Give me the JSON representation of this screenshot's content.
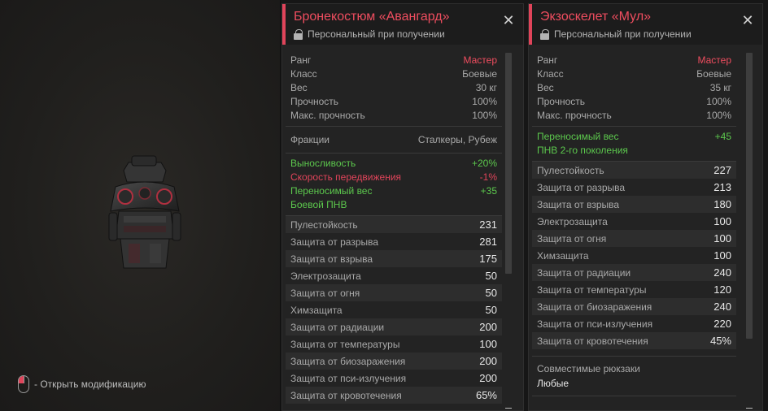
{
  "preview": {
    "hint": "- Открыть модификацию"
  },
  "cards": [
    {
      "title": "Бронекостюм «Авангард»",
      "subtitle": "Персональный при получении",
      "info": [
        {
          "label": "Ранг",
          "value": "Мастер"
        },
        {
          "label": "Класс",
          "value": "Боевые"
        },
        {
          "label": "Вес",
          "value": "30 кг"
        },
        {
          "label": "Прочность",
          "value": "100%"
        },
        {
          "label": "Макс. прочность",
          "value": "100%"
        }
      ],
      "factions": {
        "label": "Фракции",
        "value": "Сталкеры, Рубеж"
      },
      "bonuses": [
        {
          "label": "Выносливость",
          "value": "+20%"
        },
        {
          "label": "Скорость передвижения",
          "value": "-1%"
        },
        {
          "label": "Переносимый вес",
          "value": "+35"
        },
        {
          "label": "Боевой ПНВ",
          "value": ""
        }
      ],
      "stats": [
        {
          "label": "Пулестойкость",
          "value": "231"
        },
        {
          "label": "Защита от разрыва",
          "value": "281"
        },
        {
          "label": "Защита от взрыва",
          "value": "175"
        },
        {
          "label": "Электрозащита",
          "value": "50"
        },
        {
          "label": "Защита от огня",
          "value": "50"
        },
        {
          "label": "Химзащита",
          "value": "50"
        },
        {
          "label": "Защита от радиации",
          "value": "200"
        },
        {
          "label": "Защита от температуры",
          "value": "100"
        },
        {
          "label": "Защита от биозаражения",
          "value": "200"
        },
        {
          "label": "Защита от пси-излучения",
          "value": "200"
        },
        {
          "label": "Защита от кровотечения",
          "value": "65%"
        }
      ]
    },
    {
      "title": "Экзоскелет «Мул»",
      "subtitle": "Персональный при получении",
      "info": [
        {
          "label": "Ранг",
          "value": "Мастер"
        },
        {
          "label": "Класс",
          "value": "Боевые"
        },
        {
          "label": "Вес",
          "value": "35 кг"
        },
        {
          "label": "Прочность",
          "value": "100%"
        },
        {
          "label": "Макс. прочность",
          "value": "100%"
        }
      ],
      "bonuses": [
        {
          "label": "Переносимый вес",
          "value": "+45"
        },
        {
          "label": "ПНВ 2-го поколения",
          "value": ""
        }
      ],
      "stats": [
        {
          "label": "Пулестойкость",
          "value": "227"
        },
        {
          "label": "Защита от разрыва",
          "value": "213"
        },
        {
          "label": "Защита от взрыва",
          "value": "180"
        },
        {
          "label": "Электрозащита",
          "value": "100"
        },
        {
          "label": "Защита от огня",
          "value": "100"
        },
        {
          "label": "Химзащита",
          "value": "100"
        },
        {
          "label": "Защита от радиации",
          "value": "240"
        },
        {
          "label": "Защита от температуры",
          "value": "120"
        },
        {
          "label": "Защита от биозаражения",
          "value": "240"
        },
        {
          "label": "Защита от пси-излучения",
          "value": "220"
        },
        {
          "label": "Защита от кровотечения",
          "value": "45%"
        }
      ],
      "compat": {
        "label": "Совместимые рюкзаки",
        "value": "Любые"
      }
    }
  ],
  "colors": {
    "accent": "#e0445a",
    "positive": "#5cc84d",
    "panel": "#232323"
  }
}
